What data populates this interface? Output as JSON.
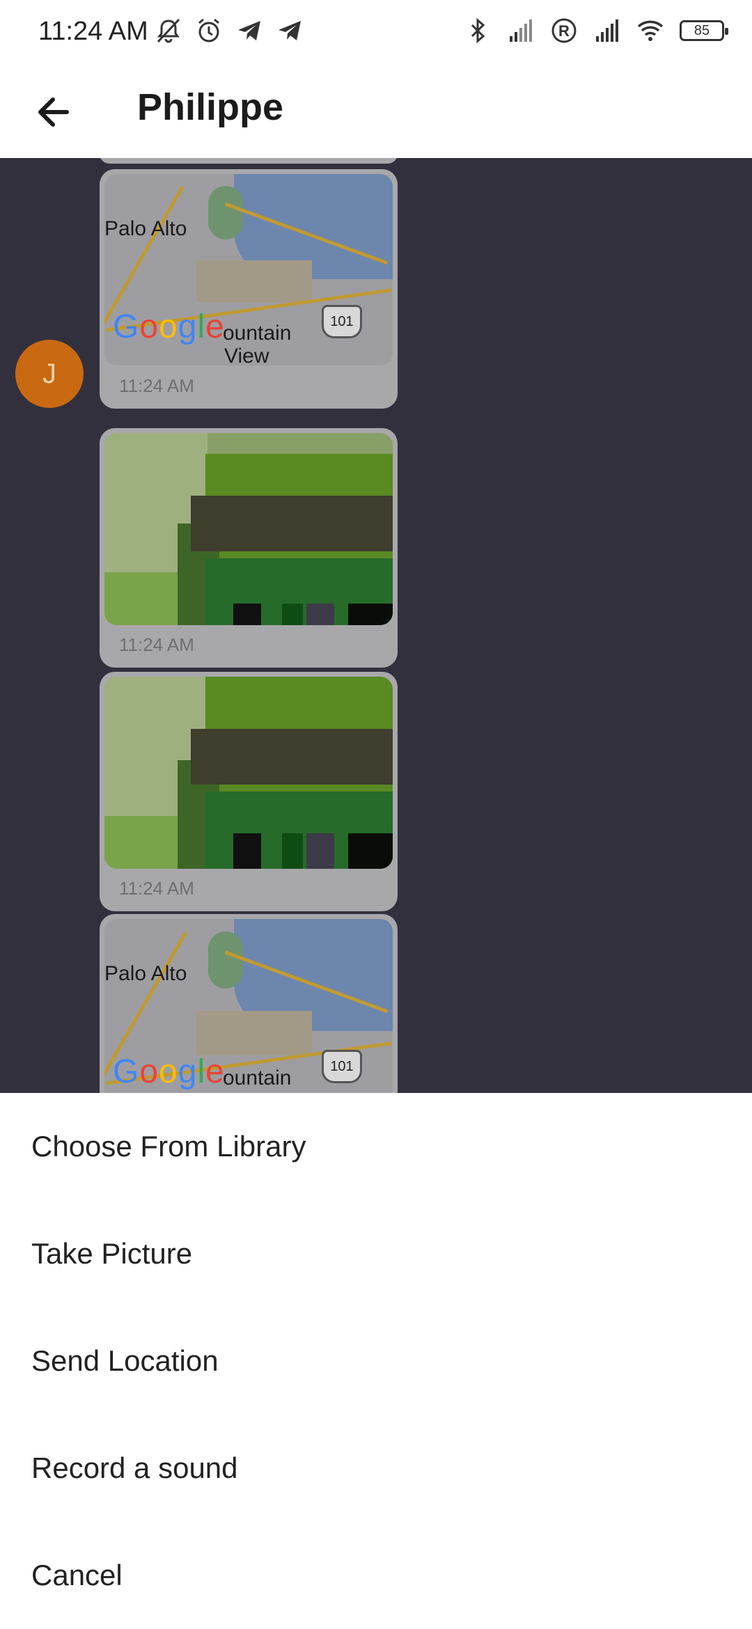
{
  "status_bar": {
    "time": "11:24 AM",
    "battery": "85",
    "icons_left": [
      "mute-icon",
      "alarm-icon",
      "telegram-icon",
      "telegram-icon"
    ],
    "icons_right": [
      "bluetooth-icon",
      "signal-icon",
      "roaming-icon",
      "signal-icon",
      "wifi-icon",
      "battery-icon"
    ]
  },
  "app_bar": {
    "title": "Philippe",
    "back_icon": "arrow-left-icon"
  },
  "chat": {
    "avatar_initial": "J",
    "avatar_color": "#c96a12",
    "messages": [
      {
        "type": "map",
        "timestamp": "11:24 AM",
        "labels": {
          "city1": "Palo Alto",
          "city2": "ountain",
          "city3": "View",
          "highway": "101"
        }
      },
      {
        "type": "image",
        "timestamp": "11:24 AM"
      },
      {
        "type": "image",
        "timestamp": "11:24 AM"
      },
      {
        "type": "map",
        "timestamp": "",
        "labels": {
          "city1": "Palo Alto",
          "city2": "ountain",
          "highway": "101"
        }
      }
    ],
    "google_logo": "Google"
  },
  "sheet": {
    "items": [
      "Choose From Library",
      "Take Picture",
      "Send Location",
      "Record a sound",
      "Cancel"
    ]
  },
  "colors": {
    "chat_background": "#33303e",
    "bubble": "#a8a8ab"
  }
}
